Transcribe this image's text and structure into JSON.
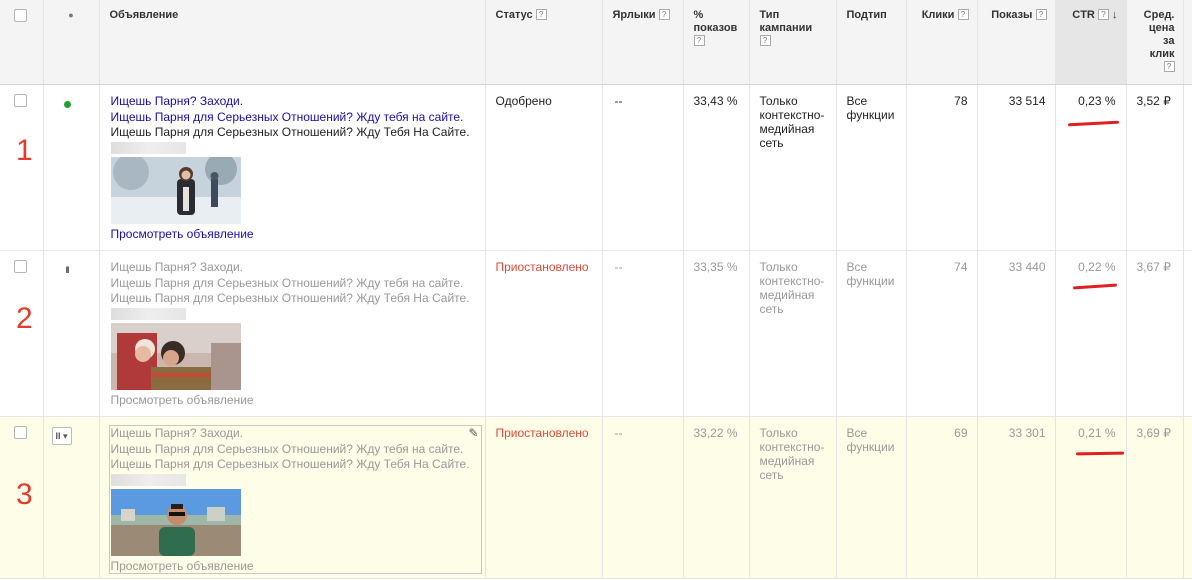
{
  "header": {
    "status_dot": "●",
    "ad": "Объявление",
    "status": "Статус",
    "labels": "Ярлыки",
    "pct_impr": [
      "%",
      "показов"
    ],
    "campaign_type": [
      "Тип",
      "кампании"
    ],
    "subtype": "Подтип",
    "clicks": "Клики",
    "impressions": "Показы",
    "ctr": "CTR",
    "avg_cpc": [
      "Сред.",
      "цена",
      "за",
      "клик"
    ],
    "help": "?",
    "sort_arrow": "↓"
  },
  "rows": [
    {
      "number": "1",
      "state": "active",
      "headline": "Ищешь Парня? Заходи.",
      "desc1": "Ищешь Парня для Серьезных Отношений? Жду тебя на сайте.",
      "desc2": "Ищешь Парня для Серьезных Отношений? Жду Тебя На Сайте.",
      "view_link": "Просмотреть объявление",
      "status": "Одобрено",
      "labels": "--",
      "pct_impr": "33,43 %",
      "campaign_type": [
        "Только",
        "контекстно-",
        "медийная",
        "сеть"
      ],
      "subtype": [
        "Все",
        "функции"
      ],
      "clicks": "78",
      "impressions": "33 514",
      "ctr": "0,23 %",
      "avg_cpc": "3,52 ₽"
    },
    {
      "number": "2",
      "state": "paused",
      "headline": "Ищешь Парня? Заходи.",
      "desc1": "Ищешь Парня для Серьезных Отношений? Жду тебя на сайте.",
      "desc2": "Ищешь Парня для Серьезных Отношений? Жду Тебя На Сайте.",
      "view_link": "Просмотреть объявление",
      "status": "Приостановлено",
      "labels": "--",
      "pct_impr": "33,35 %",
      "campaign_type": [
        "Только",
        "контекстно-",
        "медийная",
        "сеть"
      ],
      "subtype": [
        "Все",
        "функции"
      ],
      "clicks": "74",
      "impressions": "33 440",
      "ctr": "0,22 %",
      "avg_cpc": "3,67 ₽"
    },
    {
      "number": "3",
      "state": "paused",
      "headline": "Ищешь Парня? Заходи.",
      "desc1": "Ищешь Парня для Серьезных Отношений? Жду тебя на сайте.",
      "desc2": "Ищешь Парня для Серьезных Отношений? Жду Тебя На Сайте.",
      "view_link": "Просмотреть объявление",
      "status": "Приостановлено",
      "labels": "--",
      "pct_impr": "33,22 %",
      "campaign_type": [
        "Только",
        "контекстно-",
        "медийная",
        "сеть"
      ],
      "subtype": [
        "Все",
        "функции"
      ],
      "clicks": "69",
      "impressions": "33 301",
      "ctr": "0,21 %",
      "avg_cpc": "3,69 ₽"
    }
  ],
  "icons": {
    "pause": "II",
    "dropdown": "▾",
    "pencil": "✎"
  },
  "colors": {
    "approved_dot": "#1fa12f",
    "paused_status": "#dd4b39",
    "annotation_red": "#e53b2c",
    "ad_link": "#1a0dab",
    "edit_row_bg": "#fdfde8"
  }
}
